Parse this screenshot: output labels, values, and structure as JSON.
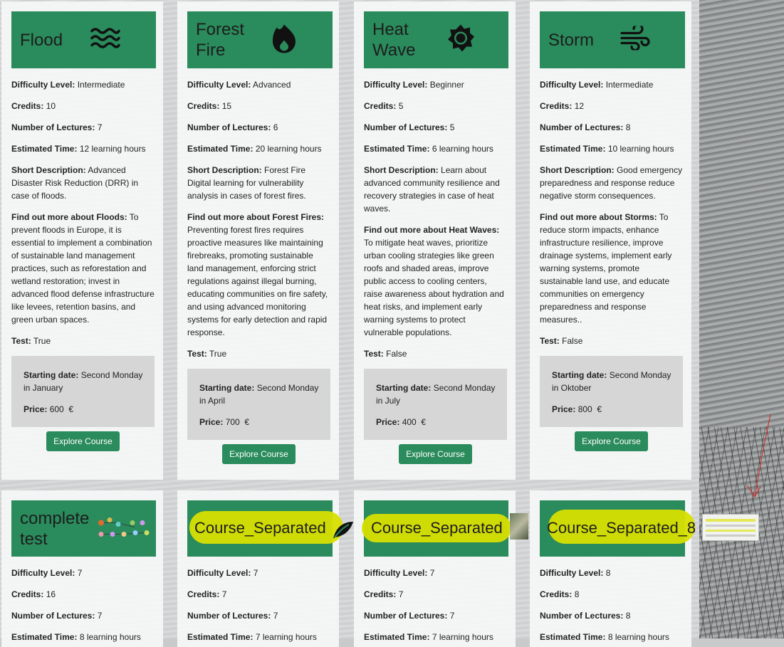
{
  "labels": {
    "difficulty": "Difficulty Level:",
    "credits": "Credits:",
    "lectures": "Number of Lectures:",
    "time": "Estimated Time:",
    "short": "Short Description:",
    "test": "Test:",
    "start": "Starting date:",
    "price": "Price:",
    "currency": "€",
    "explore": "Explore Course"
  },
  "colors": {
    "accent": "#2a8b5c",
    "highlight": "#d8df00",
    "box": "#d6d6d6"
  },
  "cards_row1": [
    {
      "title": "Flood",
      "icon": "water-waves-icon",
      "difficulty": "Intermediate",
      "credits": "10",
      "lectures": "7",
      "time": "12 learning hours",
      "short": "Advanced Disaster Risk Reduction (DRR) in case of floods.",
      "more_label": "Find out more about Floods:",
      "more": "To prevent floods in Europe, it is essential to implement a combination of sustainable land management practices, such as reforestation and wetland restoration; invest in advanced flood defense infrastructure like levees, retention basins, and green urban spaces.",
      "test": "True",
      "start": "Second Monday in January",
      "price": "600"
    },
    {
      "title": "Forest Fire",
      "icon": "fire-icon",
      "difficulty": "Advanced",
      "credits": "15",
      "lectures": "6",
      "time": "20 learning hours",
      "short": "Forest Fire Digital learning for vulnerability analysis in cases of forest fires.",
      "more_label": "Find out more about Forest Fires:",
      "more": "Preventing forest fires requires proactive measures like maintaining firebreaks, promoting sustainable land management, enforcing strict regulations against illegal burning, educating communities on fire safety, and using advanced monitoring systems for early detection and rapid response.",
      "test": "True",
      "start": "Second Monday in April",
      "price": "700"
    },
    {
      "title": "Heat Wave",
      "icon": "sun-icon",
      "difficulty": "Beginner",
      "credits": "5",
      "lectures": "5",
      "time": "6 learning hours",
      "short": "Learn about advanced community resilience and recovery strategies in case of heat waves.",
      "more_label": "Find out more about Heat Waves:",
      "more": "To mitigate heat waves, prioritize urban cooling strategies like green roofs and shaded areas, improve public access to cooling centers, raise awareness about hydration and heat risks, and implement early warning systems to protect vulnerable populations.",
      "test": "False",
      "start": "Second Monday in July",
      "price": "400"
    },
    {
      "title": "Storm",
      "icon": "wind-icon",
      "difficulty": "Intermediate",
      "credits": "12",
      "lectures": "8",
      "time": "10 learning hours",
      "short": "Good emergency preparedness and response reduce negative storm consequences.",
      "more_label": "Find out more about Storms:",
      "more": "To reduce storm impacts, enhance infrastructure resilience, improve drainage systems, implement early warning systems, promote sustainable land use, and educate communities on emergency preparedness and response measures..",
      "test": "False",
      "start": "Second Monday in Oktober",
      "price": "800"
    }
  ],
  "cards_row2": [
    {
      "title": "complete test",
      "difficulty": "7",
      "credits": "16",
      "lectures": "7",
      "time": "8 learning hours"
    },
    {
      "title": "Course_Separated",
      "difficulty": "7",
      "credits": "7",
      "lectures": "7",
      "time": "7 learning hours"
    },
    {
      "title": "Course_Separated",
      "difficulty": "7",
      "credits": "7",
      "lectures": "7",
      "time": "7 learning hours"
    },
    {
      "title": "Course_Separated_8",
      "difficulty": "8",
      "credits": "8",
      "lectures": "8",
      "time": "8 learning hours"
    }
  ]
}
